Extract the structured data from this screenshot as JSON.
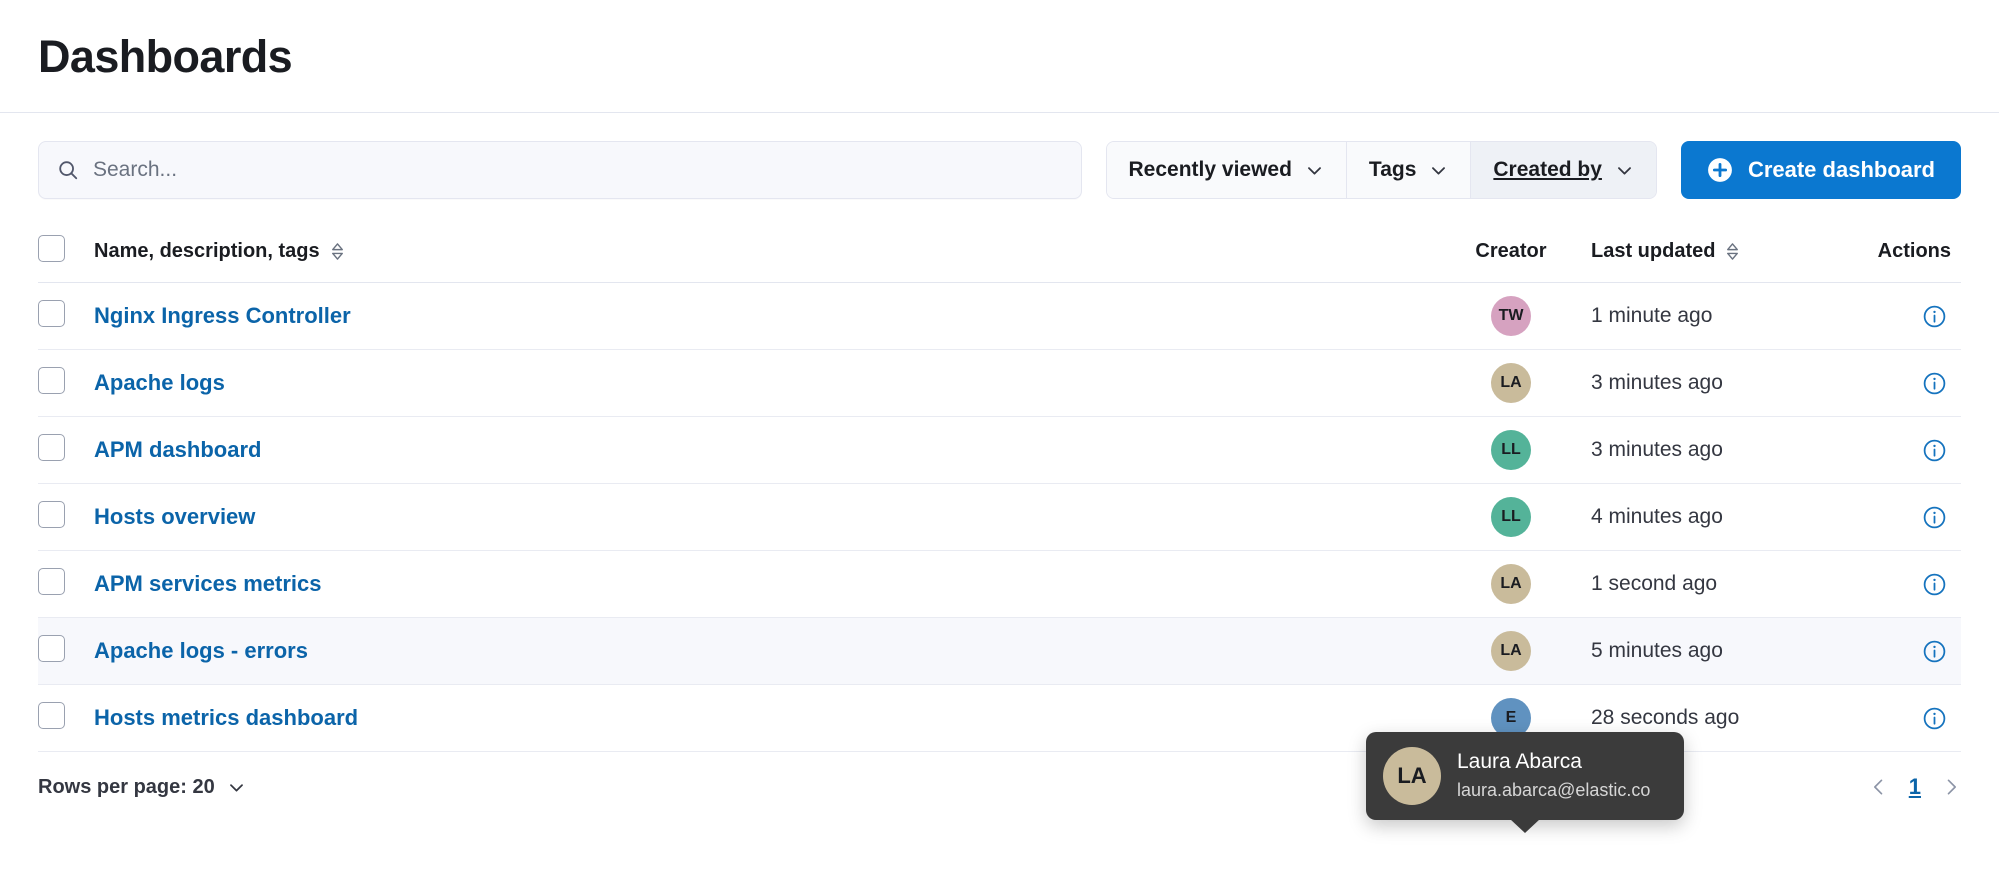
{
  "header": {
    "title": "Dashboards"
  },
  "search": {
    "placeholder": "Search...",
    "value": "",
    "icon": "search-icon"
  },
  "filters": [
    {
      "label": "Recently viewed",
      "state": "default"
    },
    {
      "label": "Tags",
      "state": "default"
    },
    {
      "label": "Created by",
      "state": "hover"
    }
  ],
  "create_button": {
    "label": "Create dashboard",
    "icon": "plus-in-circle-icon",
    "color": "#0B78D0"
  },
  "table": {
    "columns": {
      "name": "Name, description, tags",
      "creator": "Creator",
      "updated": "Last updated",
      "actions": "Actions"
    },
    "rows": [
      {
        "name": "Nginx Ingress Controller",
        "creator_initials": "TW",
        "creator_color": "#D6A2C0",
        "updated": "1 minute ago",
        "hover": false
      },
      {
        "name": "Apache logs",
        "creator_initials": "LA",
        "creator_color": "#C9BB9B",
        "updated": "3 minutes ago",
        "hover": false
      },
      {
        "name": "APM dashboard",
        "creator_initials": "LL",
        "creator_color": "#54B399",
        "updated": "3 minutes ago",
        "hover": false
      },
      {
        "name": "Hosts overview",
        "creator_initials": "LL",
        "creator_color": "#54B399",
        "updated": "4 minutes ago",
        "hover": false
      },
      {
        "name": "APM services metrics",
        "creator_initials": "LA",
        "creator_color": "#C9BB9B",
        "updated": "1 second ago",
        "hover": false
      },
      {
        "name": "Apache logs - errors",
        "creator_initials": "LA",
        "creator_color": "#C9BB9B",
        "updated": "5 minutes ago",
        "hover": true
      },
      {
        "name": "Hosts metrics dashboard",
        "creator_initials": "E",
        "creator_color": "#6092C0",
        "updated": "28 seconds ago",
        "hover": false
      }
    ]
  },
  "tooltip": {
    "initials": "LA",
    "avatar_color": "#C9BB9B",
    "name": "Laura Abarca",
    "email": "laura.abarca@elastic.co",
    "background": "#3B3B3B"
  },
  "footer": {
    "rows_per_page_label": "Rows per page: 20",
    "current_page": "1",
    "prev_icon": "chevron-left-icon",
    "next_icon": "chevron-right-icon"
  }
}
